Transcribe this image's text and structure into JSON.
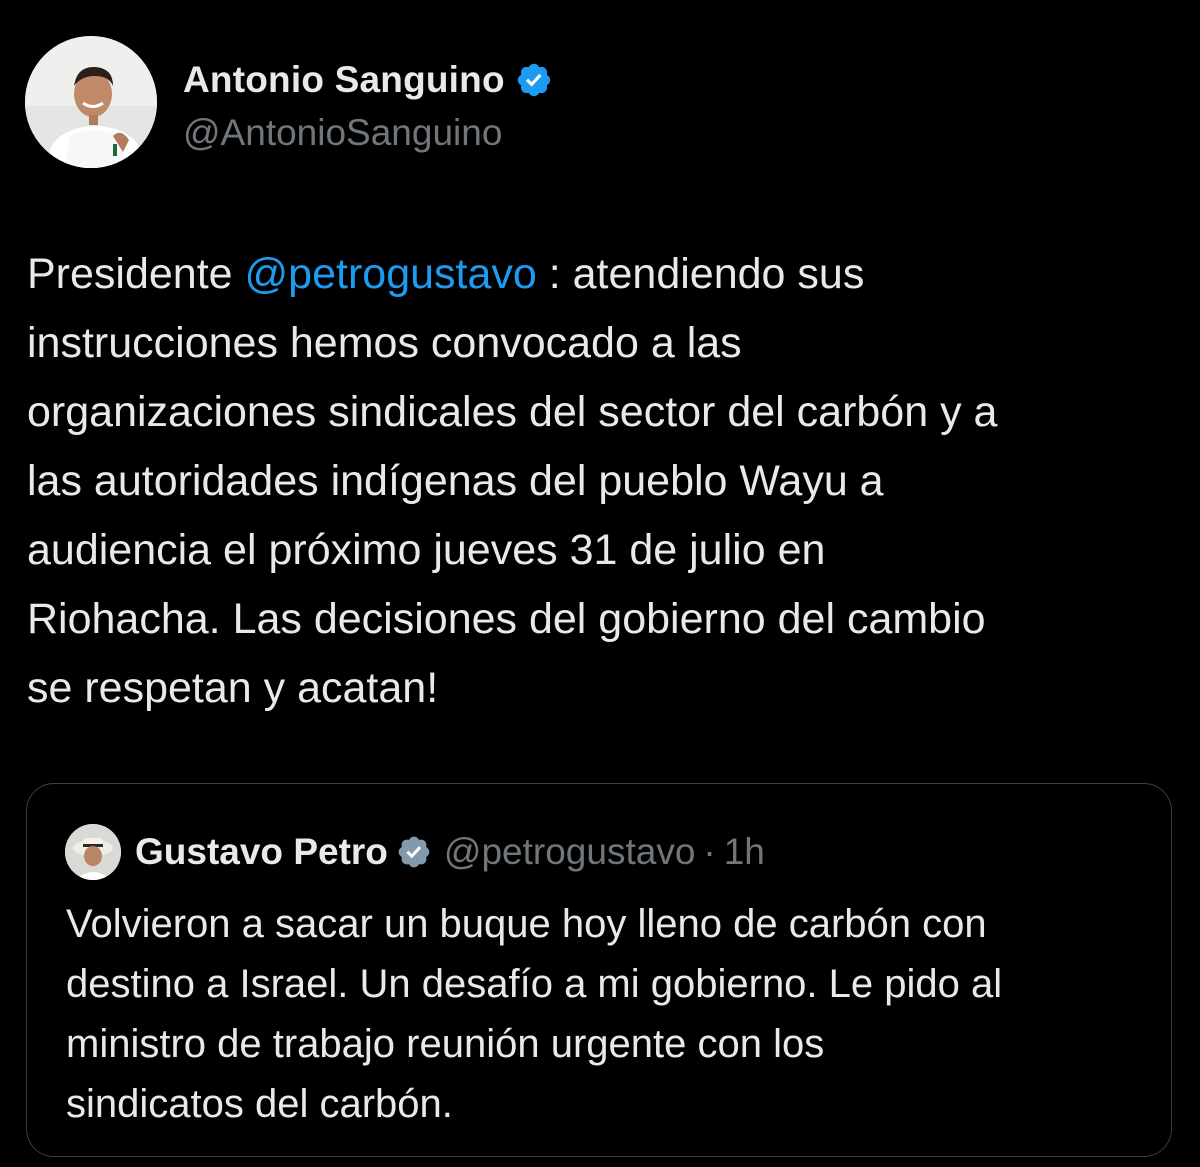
{
  "author": {
    "display_name": "Antonio Sanguino",
    "handle": "@AntonioSanguino",
    "verified": true,
    "avatar_icon": "profile-photo"
  },
  "tweet": {
    "text_before": "Presidente ",
    "mention": "@petrogustavo",
    "text_after": " : atendiendo sus\ninstrucciones hemos convocado a las\norganizaciones sindicales del sector del carbón y a\nlas autoridades indígenas del pueblo Wayu a\naudiencia el próximo jueves 31 de julio en\nRiohacha. Las decisiones del gobierno del cambio\nse respetan y acatan!"
  },
  "quoted_tweet": {
    "display_name": "Gustavo Petro",
    "handle": "@petrogustavo",
    "separator": "·",
    "time": "1h",
    "verified": true,
    "text": "Volvieron a sacar un buque hoy lleno de carbón con\ndestino a Israel. Un desafío a mi gobierno. Le pido al\nministro de trabajo reunión urgente con los\nsindicatos del carbón."
  },
  "colors": {
    "background": "#000000",
    "text": "#e7e9ea",
    "muted": "#71767b",
    "link": "#1d9bf0",
    "verified_blue": "#1d9bf0",
    "verified_gray": "#829aab",
    "border": "#3a3f44"
  }
}
